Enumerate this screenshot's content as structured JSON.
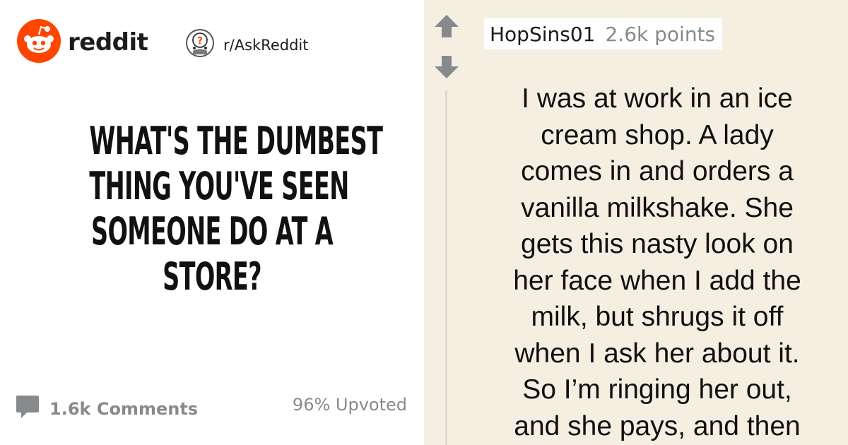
{
  "header": {
    "brand_name": "reddit",
    "subreddit": "r/AskReddit"
  },
  "post": {
    "title_lines": [
      "WHAT'S THE DUMBEST",
      "THING YOU'VE SEEN",
      "SOMEONE DO AT A",
      "STORE?"
    ],
    "comments_label": "1.6k Comments",
    "upvoted_label": "96% Upvoted"
  },
  "comment": {
    "username": "HopSins01",
    "points": "2.6k points",
    "body_lines": [
      "I was at work in an ice",
      "cream shop. A lady",
      "comes in and orders a",
      "vanilla milkshake. She",
      "gets this nasty look on",
      "her face when I add the",
      "milk, but shrugs it off",
      "when I ask her about it.",
      "So I’m ringing her out,",
      "and she pays, and then"
    ]
  },
  "icons": {
    "brand_logo": "reddit-snoo-logo",
    "subreddit_icon": "askreddit-icon",
    "comment_icon": "comment-bubble-icon",
    "upvote_icon": "upvote-arrow-icon",
    "downvote_icon": "downvote-arrow-icon"
  },
  "colors": {
    "brand_orange": "#ff4500",
    "meta_gray": "#878a8c",
    "comment_bg": "#f4efe1"
  }
}
